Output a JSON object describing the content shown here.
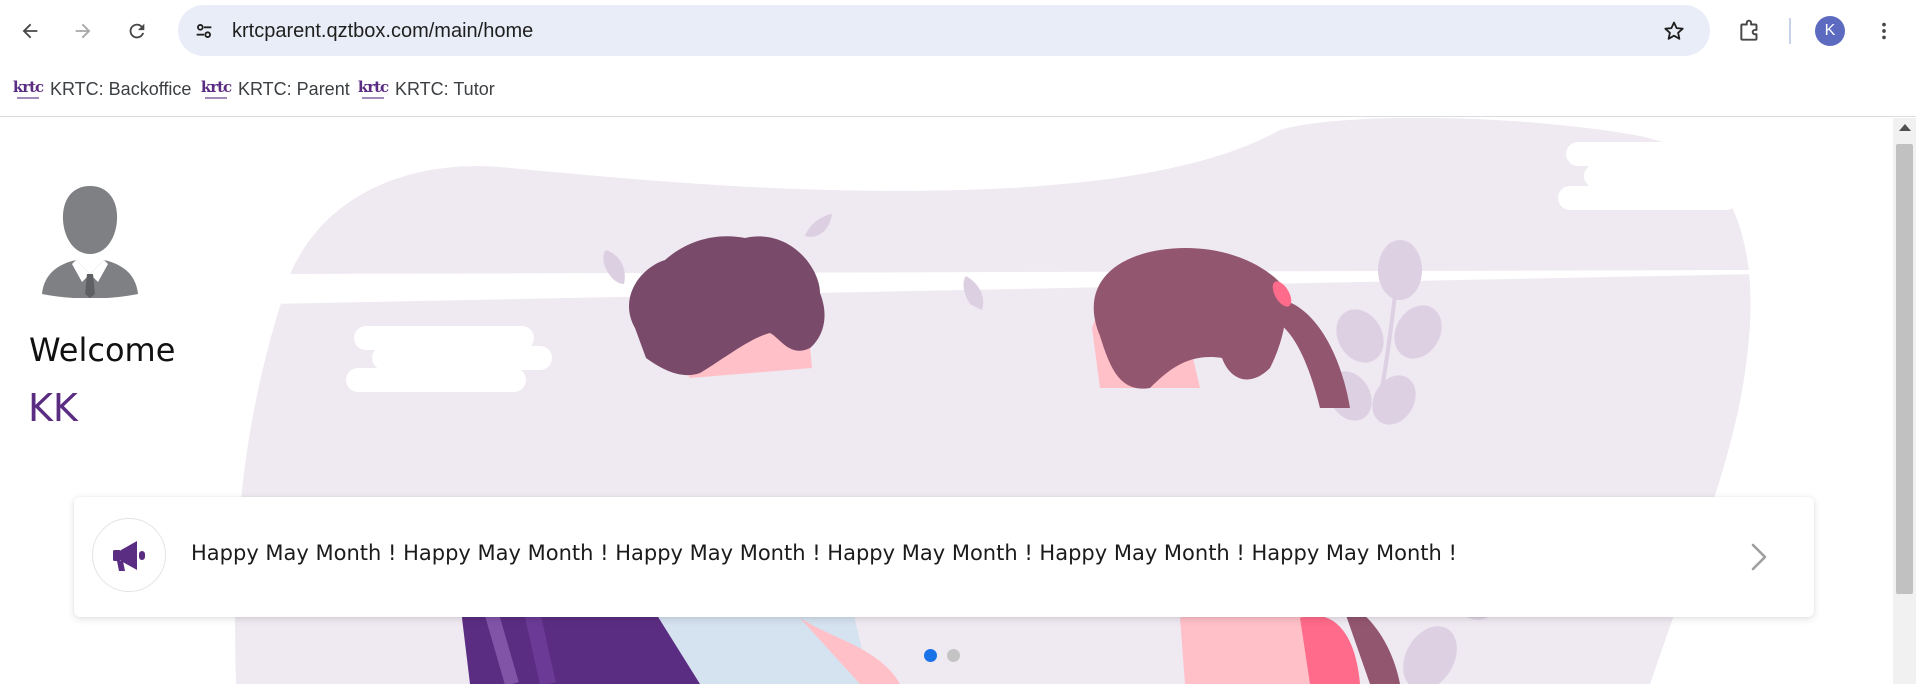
{
  "browser": {
    "url": "krtcparent.qztbox.com/main/home",
    "profile_initial": "K",
    "bookmarks": [
      {
        "logo": "krtc",
        "label": "KRTC: Backoffice"
      },
      {
        "logo": "krtc",
        "label": "KRTC: Parent"
      },
      {
        "logo": "krtc",
        "label": "KRTC: Tutor"
      }
    ],
    "icons": {
      "back": "arrow-left-icon",
      "forward": "arrow-right-icon",
      "reload": "reload-icon",
      "site_info": "tune-icon",
      "bookmark": "star-icon",
      "extensions": "puzzle-icon",
      "menu": "more-vert-icon"
    }
  },
  "page": {
    "welcome": "Welcome",
    "user_name": "KK",
    "announcement": {
      "icon": "megaphone-icon",
      "text": "Happy May Month ! Happy May Month ! Happy May Month ! Happy May Month ! Happy May Month ! Happy May Month !"
    },
    "carousel": {
      "slides": 2,
      "active_index": 0
    }
  },
  "colors": {
    "brand_purple": "#5b2d82",
    "blob": "#efe9f2",
    "active_dot": "#1a73e8",
    "omnibox": "#e9edf7"
  }
}
